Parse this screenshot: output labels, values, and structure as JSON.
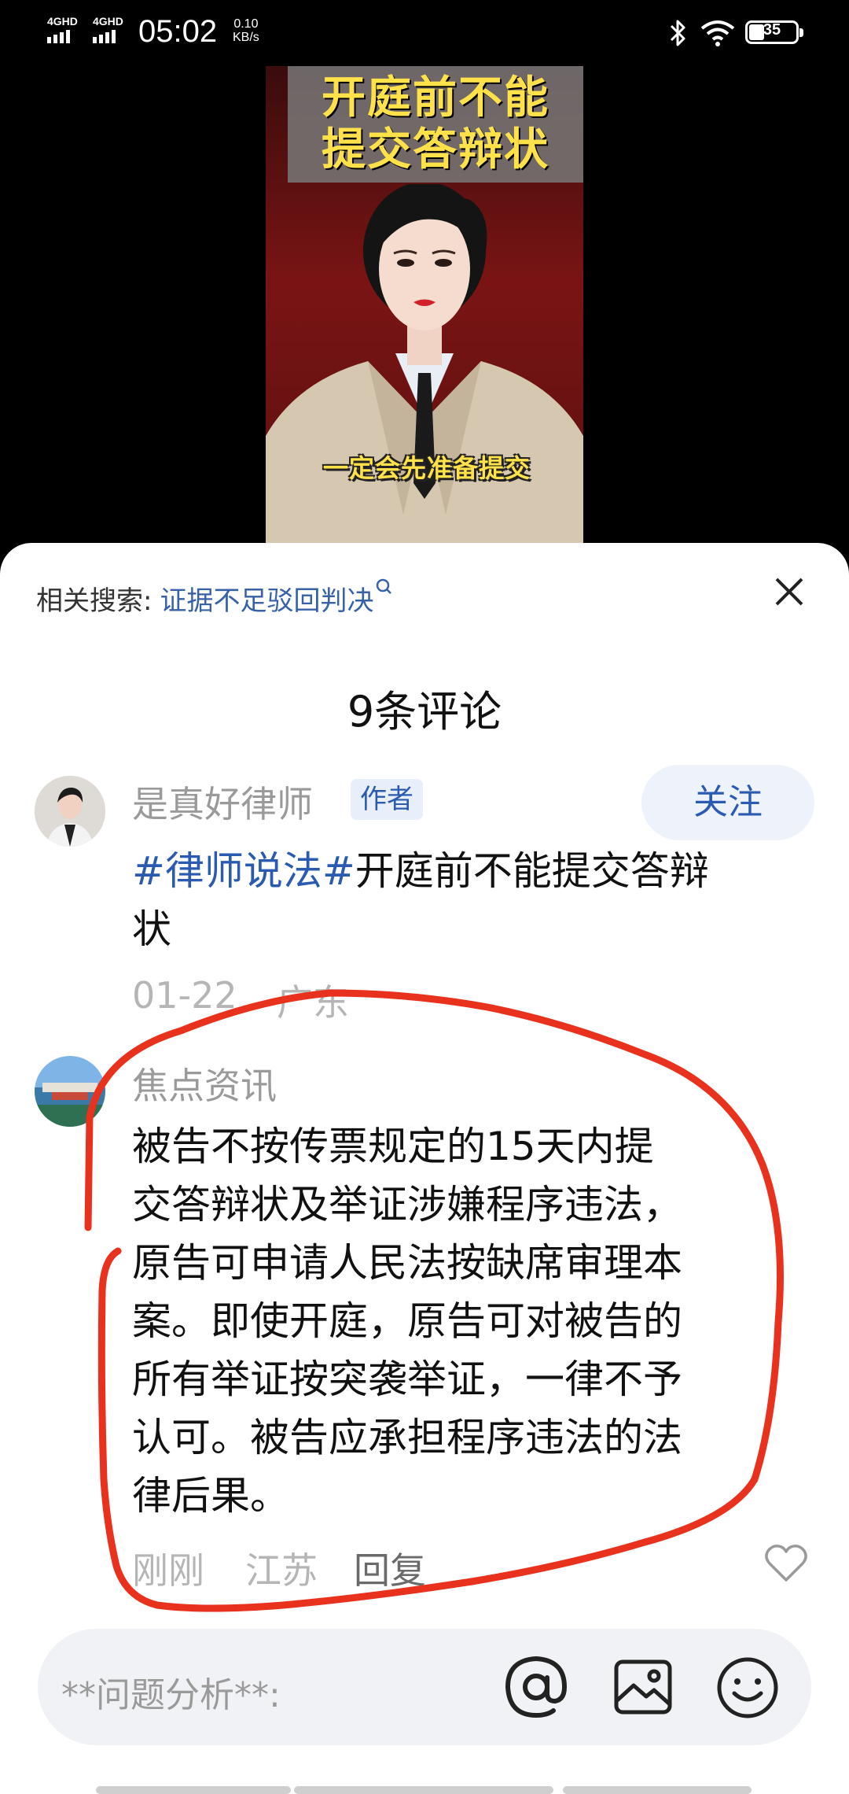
{
  "status_bar": {
    "network_1": "4GHD",
    "network_2": "4GHD",
    "time": "05:02",
    "speed_value": "0.10",
    "speed_unit": "KB/s",
    "battery": "35"
  },
  "video": {
    "title_line1": "开庭前不能",
    "title_line2": "提交答辩状",
    "subtitle": "一定会先准备提交"
  },
  "comments_panel": {
    "related_label": "相关搜索:",
    "related_query": "证据不足驳回判决",
    "title": "9条评论",
    "comments": [
      {
        "user": "是真好律师",
        "tag": "作者",
        "follow_label": "关注",
        "hashtag": "#律师说法#",
        "text_line1": "开庭前不能提交答辩",
        "text_line2": "状",
        "time": "01-22",
        "location": "广东"
      },
      {
        "user": "焦点资讯",
        "lines": [
          "被告不按传票规定的15天内提",
          "交答辩状及举证涉嫌程序违法，",
          "原告可申请人民法按缺席审理本",
          "案。即使开庭，原告可对被告的",
          "所有举证按突袭举证，一律不予",
          "认可。被告应承担程序违法的法",
          "律后果。"
        ],
        "time": "刚刚",
        "location": "江苏",
        "reply_label": "回复"
      }
    ]
  },
  "input_bar": {
    "placeholder": "**问题分析**:"
  },
  "icons": [
    "close-icon",
    "search-icon",
    "at-icon",
    "image-icon",
    "emoji-icon",
    "heart-icon",
    "bluetooth-icon",
    "wifi-icon",
    "battery-icon"
  ],
  "colors": {
    "accent": "#2a5bb0",
    "annotation": "#e8321e"
  }
}
